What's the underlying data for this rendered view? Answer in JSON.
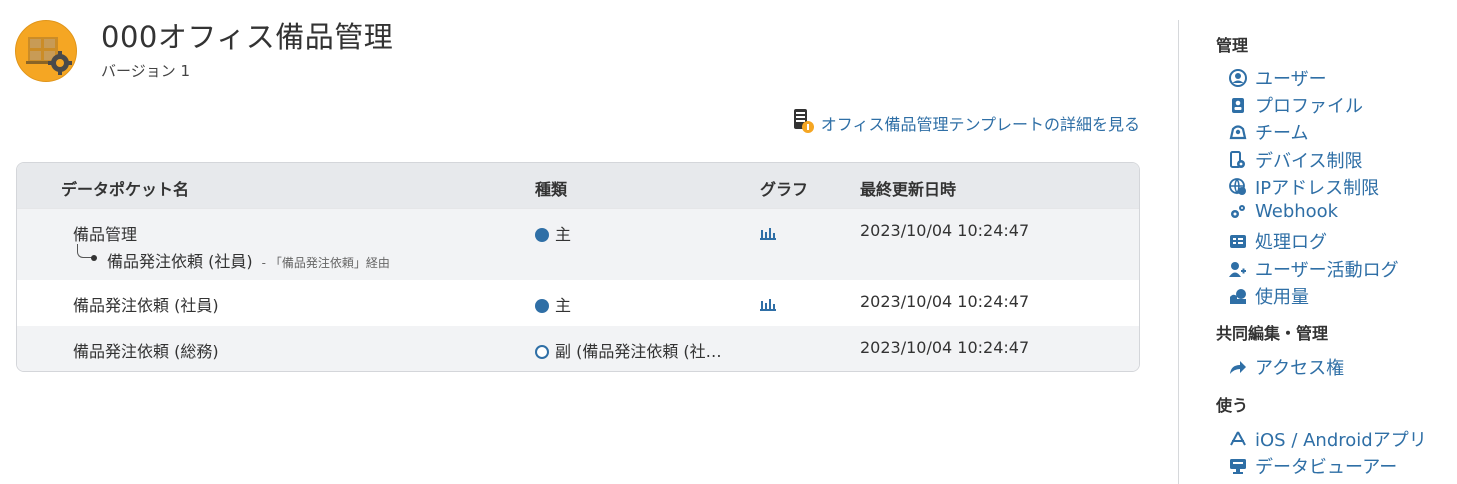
{
  "app": {
    "title": "000オフィス備品管理",
    "version": "バージョン 1"
  },
  "template_link": {
    "label": "オフィス備品管理テンプレートの詳細を見る"
  },
  "table": {
    "columns": [
      "データポケット名",
      "種類",
      "グラフ",
      "最終更新日時"
    ],
    "rows": [
      {
        "name": "備品管理",
        "child_name": "備品発注依頼 (社員)",
        "child_via": "- 「備品発注依頼」経由",
        "type": "主",
        "type_kind": "main",
        "has_graph": true,
        "updated": "2023/10/04 10:24:47"
      },
      {
        "name": "備品発注依頼 (社員)",
        "type": "主",
        "type_kind": "main",
        "has_graph": true,
        "updated": "2023/10/04 10:24:47"
      },
      {
        "name": "備品発注依頼 (総務)",
        "type": "副 (備品発注依頼 (社…",
        "type_kind": "sub",
        "has_graph": false,
        "updated": "2023/10/04 10:24:47"
      }
    ]
  },
  "sidebar": {
    "sections": [
      {
        "heading": "管理",
        "items": [
          {
            "label": "ユーザー",
            "icon": "user-circle-icon"
          },
          {
            "label": "プロファイル",
            "icon": "profile-card-icon"
          },
          {
            "label": "チーム",
            "icon": "team-icon"
          },
          {
            "label": "デバイス制限",
            "icon": "device-lock-icon"
          },
          {
            "label": "IPアドレス制限",
            "icon": "globe-lock-icon"
          },
          {
            "label": "Webhook",
            "icon": "webhook-icon"
          },
          {
            "label": "処理ログ",
            "icon": "log-icon"
          },
          {
            "label": "ユーザー活動ログ",
            "icon": "user-activity-icon"
          },
          {
            "label": "使用量",
            "icon": "usage-icon"
          }
        ]
      },
      {
        "heading": "共同編集・管理",
        "items": [
          {
            "label": "アクセス権",
            "icon": "share-arrow-icon"
          }
        ]
      },
      {
        "heading": "使う",
        "items": [
          {
            "label": "iOS / Androidアプリ",
            "icon": "app-store-icon"
          },
          {
            "label": "データビューアー",
            "icon": "monitor-icon"
          }
        ]
      }
    ]
  },
  "colors": {
    "accent": "#2f6fa6",
    "header_bg": "#e7e9ec",
    "app_icon": "#f5a623"
  }
}
